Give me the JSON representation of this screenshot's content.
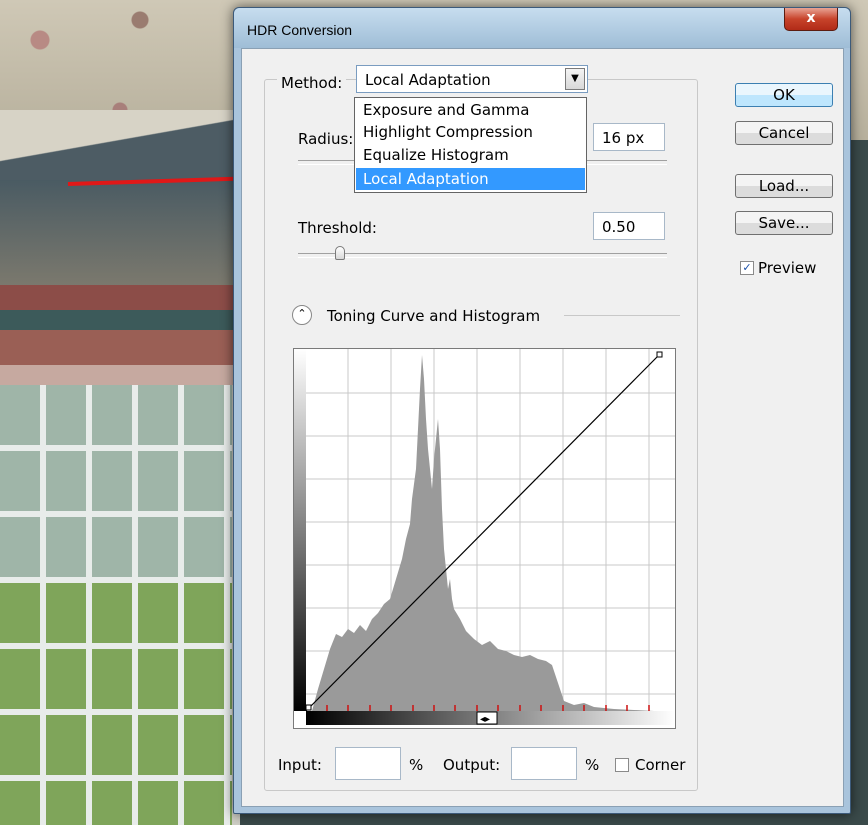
{
  "dialog": {
    "title": "HDR Conversion",
    "close_glyph": "x"
  },
  "method": {
    "label": "Method:",
    "selected": "Local Adaptation",
    "options": [
      "Exposure and Gamma",
      "Highlight Compression",
      "Equalize Histogram",
      "Local Adaptation"
    ]
  },
  "radius": {
    "label": "Radius:",
    "value": "16 px"
  },
  "threshold": {
    "label": "Threshold:",
    "value": "0.50",
    "slider_fraction": 0.12
  },
  "toning": {
    "label": "Toning Curve and Histogram",
    "toggle_glyph": "⌃"
  },
  "footer": {
    "input_label": "Input:",
    "input_value": "",
    "input_unit": "%",
    "output_label": "Output:",
    "output_value": "",
    "output_unit": "%",
    "corner_label": "Corner"
  },
  "buttons": {
    "ok": "OK",
    "cancel": "Cancel",
    "load": "Load...",
    "save": "Save..."
  },
  "preview": {
    "label": "Preview",
    "checked": true
  },
  "colors": {
    "selection": "#3399ff",
    "arrow": "#e01818",
    "histogram": "#9a9a9a"
  }
}
